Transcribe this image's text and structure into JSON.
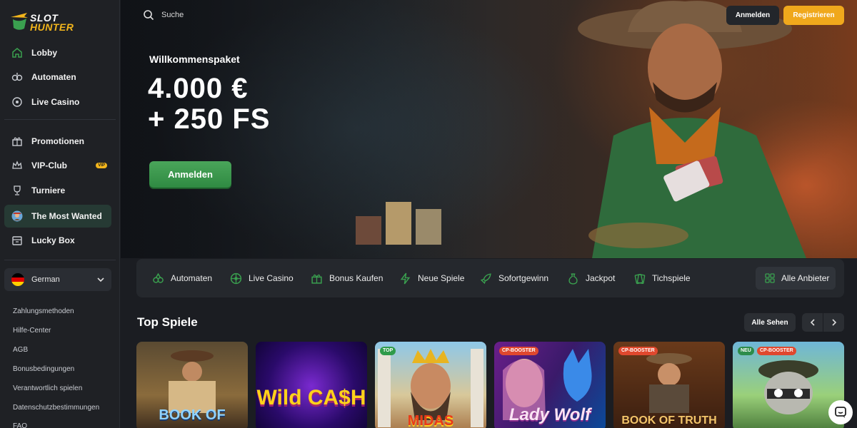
{
  "brand": {
    "line1": "SLOT",
    "line2": "HUNTER",
    "accent": "#f2b51c",
    "green": "#3aa04f"
  },
  "sidebar": {
    "items": [
      {
        "label": "Lobby",
        "icon": "home-icon"
      },
      {
        "label": "Automaten",
        "icon": "slot-machine-icon"
      },
      {
        "label": "Live Casino",
        "icon": "roulette-icon"
      },
      {
        "label": "Promotionen",
        "icon": "gift-icon"
      },
      {
        "label": "VIP-Club",
        "icon": "crown-icon",
        "badge": "VIP"
      },
      {
        "label": "Turniere",
        "icon": "trophy-icon"
      },
      {
        "label": "The Most Wanted",
        "icon": "wanted-avatar-icon"
      },
      {
        "label": "Lucky Box",
        "icon": "box-icon"
      }
    ],
    "language": "German",
    "footer_links": [
      "Zahlungsmethoden",
      "Hilfe-Center",
      "AGB",
      "Bonusbedingungen",
      "Verantwortlich spielen",
      "Datenschutzbestimmungen",
      "FAQ"
    ]
  },
  "header": {
    "search_placeholder": "Suche",
    "login_label": "Anmelden",
    "register_label": "Registrieren"
  },
  "hero": {
    "subtitle": "Willkommenspaket",
    "line1": "4.000 €",
    "line2": "+ 250 FS",
    "cta": "Anmelden"
  },
  "categories": [
    {
      "label": "Automaten",
      "icon": "slot-icon"
    },
    {
      "label": "Live Casino",
      "icon": "roulette-icon"
    },
    {
      "label": "Bonus Kaufen",
      "icon": "bonus-buy-icon"
    },
    {
      "label": "Neue Spiele",
      "icon": "lightning-icon"
    },
    {
      "label": "Sofortgewinn",
      "icon": "rocket-icon"
    },
    {
      "label": "Jackpot",
      "icon": "money-bag-icon"
    },
    {
      "label": "Tichspiele",
      "icon": "cards-icon"
    }
  ],
  "all_providers": "Alle Anbieter",
  "top_games": {
    "title": "Top Spiele",
    "see_all": "Alle Sehen",
    "games": [
      {
        "title": "BOOK OF",
        "tags": []
      },
      {
        "title": "Wild CA$H",
        "tags": []
      },
      {
        "title": "MIDAS",
        "tags": [
          "TOP"
        ]
      },
      {
        "title": "Lady Wolf",
        "tags": [
          "CP-BOOSTER"
        ]
      },
      {
        "title": "BOOK OF TRUTH",
        "tags": [
          "CP-BOOSTER"
        ]
      },
      {
        "title": "",
        "tags": [
          "NEU",
          "CP-BOOSTER"
        ]
      }
    ]
  }
}
